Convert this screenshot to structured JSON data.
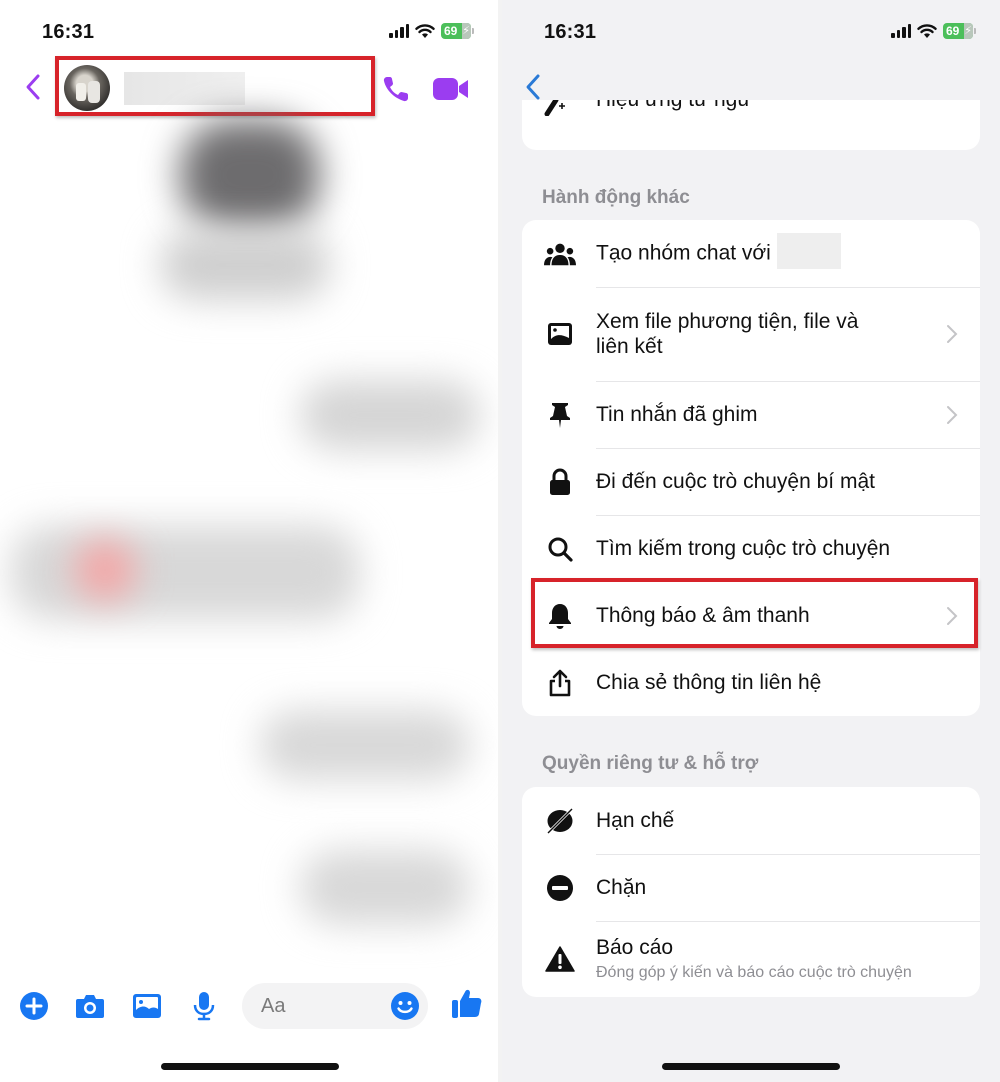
{
  "left_screen": {
    "status_bar": {
      "time": "16:31",
      "battery_level": "69",
      "charging": true
    },
    "header": {
      "back_icon": "chevron-left-icon",
      "contact_name": "",
      "call_icon": "phone-icon",
      "video_icon": "video-camera-icon",
      "accent_color": "#9b3df0",
      "highlighted": true
    },
    "composer": {
      "icons": [
        "plus-circle-icon",
        "camera-icon",
        "image-icon",
        "microphone-icon"
      ],
      "input_placeholder": "Aa",
      "emoji_icon": "smiley-icon",
      "like_icon": "thumbs-up-icon",
      "accent_color": "#1877f2"
    }
  },
  "right_screen": {
    "status_bar": {
      "time": "16:31",
      "battery_level": "69",
      "charging": true
    },
    "back_icon": "chevron-left-icon",
    "partial_item": {
      "label": "Hiệu ứng từ ngữ",
      "icon": "magic-wand-icon"
    },
    "sections": [
      {
        "title": "Hành động khác",
        "items": [
          {
            "label": "Tạo nhóm chat với",
            "icon": "group-icon",
            "chevron": false,
            "redacted_suffix": true
          },
          {
            "label": "Xem file phương tiện, file và liên kết",
            "icon": "image-icon",
            "chevron": true
          },
          {
            "label": "Tin nhắn đã ghim",
            "icon": "pin-icon",
            "chevron": true
          },
          {
            "label": "Đi đến cuộc trò chuyện bí mật",
            "icon": "lock-icon",
            "chevron": false
          },
          {
            "label": "Tìm kiếm trong cuộc trò chuyện",
            "icon": "search-icon",
            "chevron": false
          },
          {
            "label": "Thông báo & âm thanh",
            "icon": "bell-icon",
            "chevron": true,
            "highlighted": true
          },
          {
            "label": "Chia sẻ thông tin liên hệ",
            "icon": "share-icon",
            "chevron": false
          }
        ]
      },
      {
        "title": "Quyền riêng tư & hỗ trợ",
        "items": [
          {
            "label": "Hạn chế",
            "icon": "restrict-icon",
            "chevron": false
          },
          {
            "label": "Chặn",
            "icon": "block-icon",
            "chevron": false
          },
          {
            "label": "Báo cáo",
            "sublabel": "Đóng góp ý kiến và báo cáo cuộc trò chuyện",
            "icon": "warning-icon",
            "chevron": false
          }
        ]
      }
    ],
    "highlight_color": "#d7232a"
  }
}
